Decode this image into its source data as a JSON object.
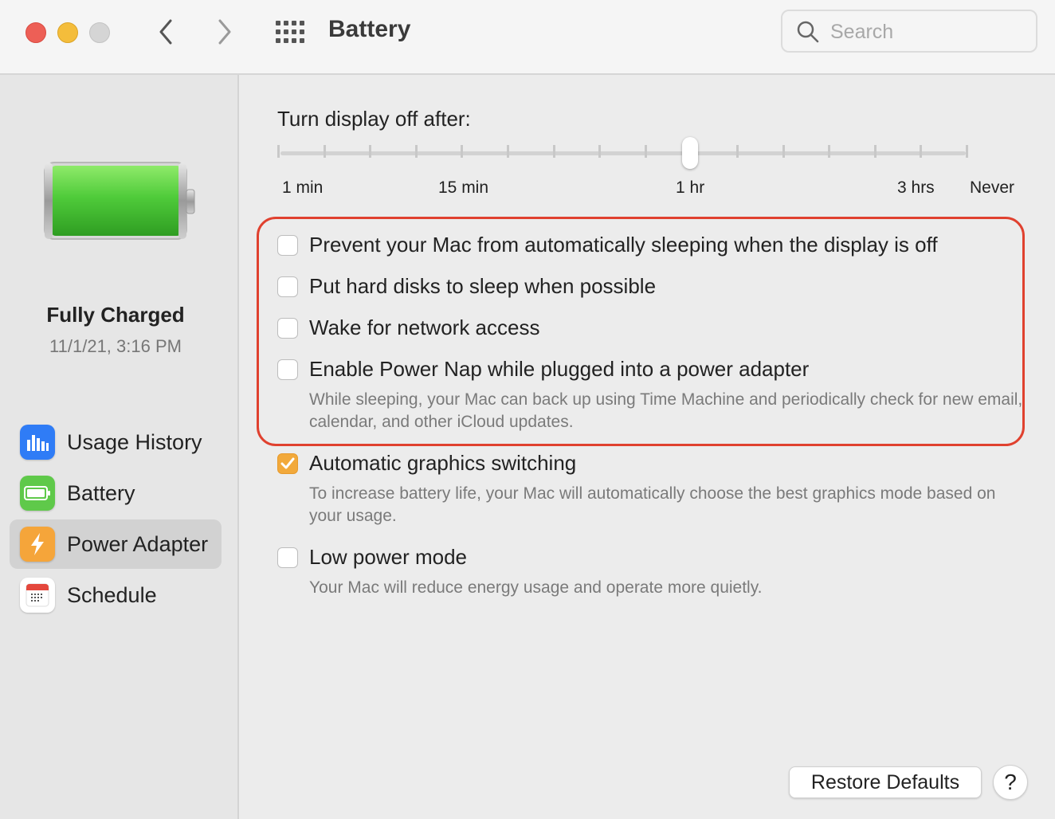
{
  "window": {
    "title": "Battery",
    "controls": [
      "close",
      "minimize",
      "zoom"
    ],
    "nav": {
      "back_icon": "chevron-left-icon",
      "forward_icon": "chevron-right-icon",
      "grid_icon": "grid-icon"
    }
  },
  "search": {
    "placeholder": "Search",
    "value": ""
  },
  "sidebar": {
    "status_title": "Fully Charged",
    "status_date": "11/1/21, 3:16 PM",
    "charge_level": 1.0,
    "items": [
      {
        "label": "Usage History",
        "icon": "bar-chart-icon",
        "selected": false
      },
      {
        "label": "Battery",
        "icon": "battery-icon",
        "selected": false
      },
      {
        "label": "Power Adapter",
        "icon": "lightning-icon",
        "selected": true
      },
      {
        "label": "Schedule",
        "icon": "calendar-icon",
        "selected": false
      }
    ]
  },
  "display_slider": {
    "title": "Turn display off after:",
    "labels": [
      "1 min",
      "15 min",
      "1 hr",
      "3 hrs",
      "Never"
    ],
    "selected": "1 hr",
    "tick_count": 16
  },
  "options": [
    {
      "label": "Prevent your Mac from automatically sleeping when the display is off",
      "checked": false,
      "description": ""
    },
    {
      "label": "Put hard disks to sleep when possible",
      "checked": false,
      "description": ""
    },
    {
      "label": "Wake for network access",
      "checked": false,
      "description": ""
    },
    {
      "label": "Enable Power Nap while plugged into a power adapter",
      "checked": false,
      "description": "While sleeping, your Mac can back up using Time Machine and periodically check for new email, calendar, and other iCloud updates."
    },
    {
      "label": "Automatic graphics switching",
      "checked": true,
      "description": "To increase battery life, your Mac will automatically choose the best graphics mode based on your usage."
    },
    {
      "label": "Low power mode",
      "checked": false,
      "description": "Your Mac will reduce energy usage and operate more quietly."
    }
  ],
  "buttons": {
    "restore_defaults": "Restore Defaults",
    "help": "?"
  },
  "colors": {
    "highlight_border": "#e0412f",
    "checkbox_checked": "#f2a93b",
    "battery_fill": "#4cc43a",
    "close": "#ed5f56",
    "minimize": "#f4bd3b",
    "zoom": "#d5d5d5"
  }
}
